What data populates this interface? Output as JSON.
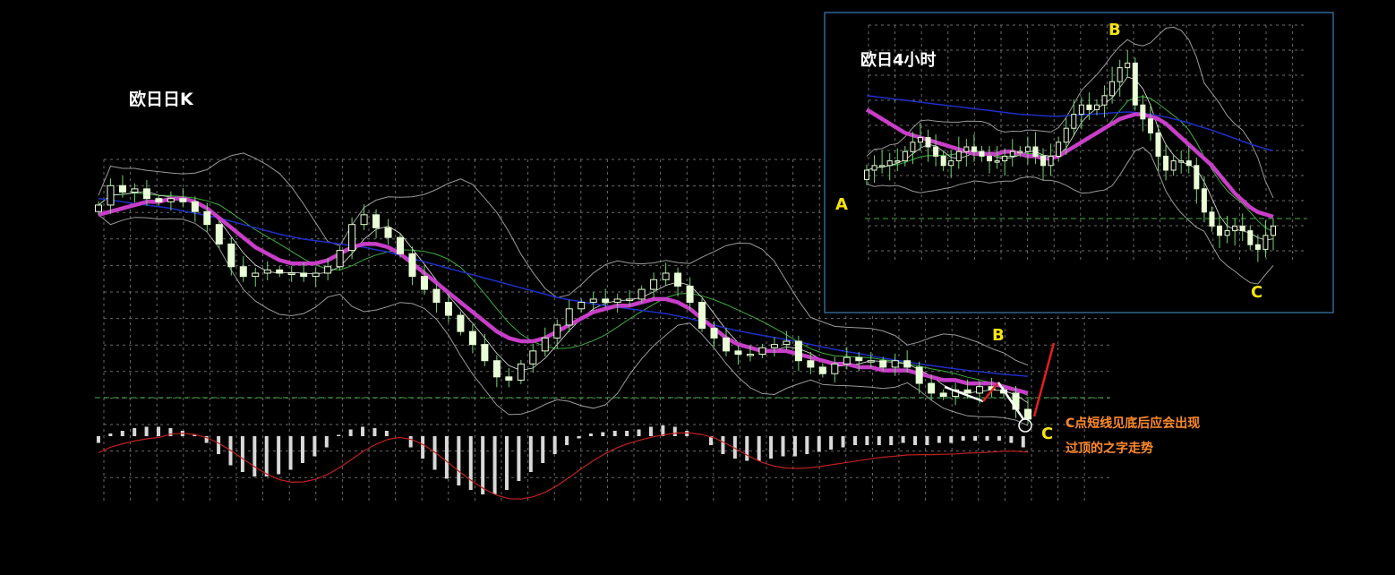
{
  "labels": {
    "main_title": "欧日日K",
    "inset_title": "欧日4小时",
    "point_a": "A",
    "point_b": "B",
    "point_c": "C",
    "note_line1": "C点短线见底后应会出现",
    "note_line2": "过顶的之字走势"
  },
  "colors": {
    "background": "#000000",
    "grid": "#6a6a6a",
    "candle_up": "#e9ffd6",
    "candle_down": "#e9ffd6",
    "candle_wick": "#6fd86f",
    "ma_thick": "#c83ec8",
    "ma_blue": "#1f2ec8",
    "ma_green": "#3fae3f",
    "ma_white": "#e8e8e8",
    "bollinger": "#9a9a9a",
    "support_line": "#3fae3f",
    "inset_border": "#3c7fb8",
    "label_yellow": "#f5e312",
    "annotation_orange": "#ff8a2b",
    "macd_hist": "#d8d8d8",
    "macd_signal": "#c02020",
    "zigzag_white": "#ffffff",
    "zigzag_red": "#e02020"
  },
  "chart_data": [
    {
      "type": "candlestick",
      "title": "欧日日K",
      "grid": true,
      "series": [
        {
          "name": "",
          "kind": "close",
          "values": [
            137.8,
            138.4,
            138.2,
            138.3,
            138.0,
            137.9,
            138.0,
            137.9,
            137.6,
            137.2,
            136.6,
            135.9,
            135.6,
            135.7,
            135.8,
            135.7,
            135.7,
            135.6,
            135.7,
            135.9,
            136.4,
            137.2,
            137.5,
            137.1,
            136.8,
            136.3,
            135.6,
            135.2,
            134.8,
            134.4,
            133.9,
            133.5,
            133.0,
            132.5,
            132.4,
            132.9,
            133.3,
            133.7,
            134.1,
            134.6,
            134.8,
            134.9,
            134.8,
            134.9,
            134.9,
            135.2,
            135.5,
            135.7,
            135.3,
            134.8,
            134.0,
            133.7,
            133.3,
            133.2,
            133.2,
            133.4,
            133.5,
            133.6,
            133.0,
            132.8,
            132.6,
            132.9,
            133.1,
            133.0,
            133.0,
            132.8,
            133.0,
            132.8,
            132.3,
            132.0,
            131.9,
            132.1,
            132.0,
            132.2,
            132.1,
            132.0,
            131.5,
            131.2
          ]
        },
        {
          "name": "",
          "kind": "moving_average_thick",
          "values": [
            137.5,
            137.6,
            137.7,
            137.8,
            137.9,
            137.9,
            138.0,
            138.0,
            137.9,
            137.7,
            137.4,
            137.1,
            136.8,
            136.5,
            136.3,
            136.1,
            136.0,
            136.0,
            136.0,
            136.1,
            136.3,
            136.5,
            136.6,
            136.6,
            136.5,
            136.3,
            136.0,
            135.7,
            135.4,
            135.1,
            134.8,
            134.5,
            134.2,
            133.9,
            133.7,
            133.6,
            133.6,
            133.7,
            133.9,
            134.1,
            134.3,
            134.5,
            134.6,
            134.7,
            134.7,
            134.8,
            134.9,
            134.9,
            134.8,
            134.6,
            134.3,
            134.0,
            133.7,
            133.5,
            133.4,
            133.3,
            133.3,
            133.3,
            133.2,
            133.1,
            133.0,
            132.9,
            132.9,
            132.8,
            132.8,
            132.7,
            132.7,
            132.7,
            132.6,
            132.5,
            132.4,
            132.4,
            132.3,
            132.3,
            132.3,
            132.2,
            132.1,
            132.0
          ]
        },
        {
          "name": "",
          "kind": "moving_average_blue",
          "values": [
            138.0,
            137.95,
            137.9,
            137.85,
            137.8,
            137.75,
            137.7,
            137.62,
            137.55,
            137.47,
            137.4,
            137.3,
            137.2,
            137.1,
            137.0,
            136.9,
            136.82,
            136.75,
            136.7,
            136.65,
            136.6,
            136.55,
            136.5,
            136.42,
            136.35,
            136.25,
            136.15,
            136.05,
            135.95,
            135.85,
            135.75,
            135.65,
            135.55,
            135.45,
            135.35,
            135.25,
            135.15,
            135.05,
            134.95,
            134.88,
            134.82,
            134.75,
            134.7,
            134.65,
            134.6,
            134.55,
            134.5,
            134.45,
            134.38,
            134.3,
            134.2,
            134.1,
            134.0,
            133.92,
            133.85,
            133.78,
            133.72,
            133.65,
            133.58,
            133.5,
            133.42,
            133.35,
            133.28,
            133.22,
            133.15,
            133.08,
            133.02,
            132.96,
            132.9,
            132.85,
            132.8,
            132.75,
            132.7,
            132.66,
            132.62,
            132.58,
            132.55,
            132.52
          ]
        },
        {
          "name": "",
          "kind": "macd_histogram",
          "values": [
            -0.3,
            0.2,
            0.4,
            0.6,
            0.7,
            0.7,
            0.6,
            0.4,
            0.1,
            -0.3,
            -0.8,
            -1.3,
            -1.6,
            -1.8,
            -1.8,
            -1.7,
            -1.5,
            -1.2,
            -0.9,
            -0.5,
            0.1,
            0.5,
            0.7,
            0.6,
            0.4,
            0.0,
            -0.5,
            -1.0,
            -1.5,
            -1.9,
            -2.2,
            -2.4,
            -2.6,
            -2.6,
            -2.4,
            -2.0,
            -1.6,
            -1.2,
            -0.8,
            -0.4,
            -0.1,
            0.2,
            0.3,
            0.4,
            0.4,
            0.5,
            0.7,
            0.8,
            0.7,
            0.4,
            0.0,
            -0.4,
            -0.8,
            -1.0,
            -1.1,
            -1.1,
            -1.0,
            -0.9,
            -0.9,
            -0.8,
            -0.7,
            -0.6,
            -0.5,
            -0.4,
            -0.4,
            -0.4,
            -0.4,
            -0.3,
            -0.4,
            -0.4,
            -0.3,
            -0.3,
            -0.2,
            -0.2,
            -0.2,
            -0.2,
            -0.3,
            -0.5
          ]
        }
      ],
      "annotations": [
        "B",
        "C",
        "C点短线见底后应会出现",
        "过顶的之字走势"
      ]
    },
    {
      "type": "candlestick",
      "title": "欧日4小时",
      "grid": true,
      "series": [
        {
          "name": "",
          "kind": "close",
          "values": [
            132.7,
            132.8,
            132.8,
            132.9,
            132.9,
            133.1,
            133.3,
            133.4,
            133.2,
            133.0,
            132.8,
            132.9,
            133.1,
            133.2,
            133.1,
            133.0,
            132.9,
            132.9,
            133.0,
            133.1,
            133.1,
            133.2,
            133.0,
            132.8,
            133.0,
            133.3,
            133.6,
            133.9,
            134.1,
            134.0,
            134.1,
            134.3,
            134.6,
            134.9,
            135.0,
            134.1,
            133.8,
            133.5,
            133.0,
            132.7,
            132.9,
            132.9,
            132.8,
            132.3,
            131.8,
            131.5,
            131.3,
            131.4,
            131.5,
            131.4,
            131.1,
            131.0,
            131.3,
            131.5
          ]
        },
        {
          "name": "",
          "kind": "moving_average_thick",
          "values": [
            134.0,
            133.9,
            133.8,
            133.7,
            133.6,
            133.5,
            133.45,
            133.4,
            133.35,
            133.3,
            133.25,
            133.2,
            133.15,
            133.1,
            133.05,
            133.05,
            133.05,
            133.05,
            133.1,
            133.1,
            133.05,
            133.0,
            133.0,
            132.95,
            132.95,
            133.0,
            133.1,
            133.2,
            133.3,
            133.4,
            133.5,
            133.6,
            133.7,
            133.8,
            133.85,
            133.9,
            133.9,
            133.85,
            133.8,
            133.7,
            133.55,
            133.4,
            133.25,
            133.1,
            132.95,
            132.8,
            132.6,
            132.4,
            132.2,
            132.05,
            131.9,
            131.8,
            131.75,
            131.7
          ]
        },
        {
          "name": "",
          "kind": "moving_average_blue",
          "values": [
            134.3,
            134.28,
            134.26,
            134.24,
            134.22,
            134.2,
            134.18,
            134.16,
            134.14,
            134.12,
            134.1,
            134.08,
            134.06,
            134.04,
            134.02,
            134.0,
            133.98,
            133.96,
            133.94,
            133.92,
            133.9,
            133.89,
            133.88,
            133.87,
            133.86,
            133.86,
            133.87,
            133.88,
            133.89,
            133.9,
            133.91,
            133.92,
            133.93,
            133.94,
            133.95,
            133.94,
            133.92,
            133.9,
            133.87,
            133.84,
            133.8,
            133.76,
            133.71,
            133.66,
            133.61,
            133.56,
            133.5,
            133.44,
            133.38,
            133.32,
            133.26,
            133.21,
            133.16,
            133.12
          ]
        }
      ],
      "annotations": [
        "A",
        "B",
        "C"
      ]
    }
  ]
}
